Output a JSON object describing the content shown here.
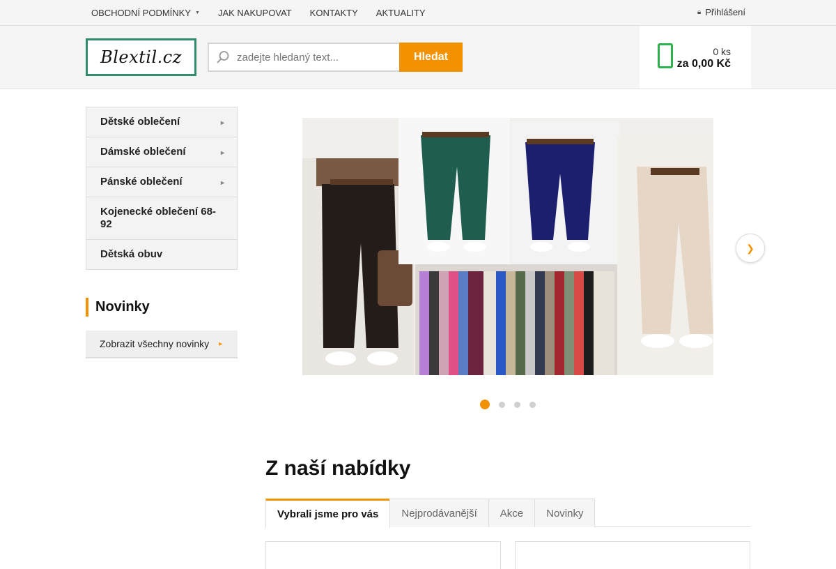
{
  "topnav": {
    "items": [
      "OBCHODNÍ PODMÍNKY",
      "JAK NAKUPOVAT",
      "KONTAKTY",
      "AKTUALITY"
    ],
    "login": "Přihlášení"
  },
  "header": {
    "logo_text": "Blextil.cz",
    "search_placeholder": "zadejte hledaný text...",
    "search_button": "Hledat",
    "cart_qty": "0 ks",
    "cart_total": "za 0,00 Kč"
  },
  "sidebar": {
    "categories": [
      {
        "label": "Dětské oblečení",
        "has_sub": true
      },
      {
        "label": "Dámské oblečení",
        "has_sub": true
      },
      {
        "label": "Pánské oblečení",
        "has_sub": true
      },
      {
        "label": "Kojenecké oblečení 68-92",
        "has_sub": false
      },
      {
        "label": "Dětská obuv",
        "has_sub": false
      }
    ],
    "news_title": "Novinky",
    "news_button": "Zobrazit všechny novinky"
  },
  "banner": {
    "slide_count": 4,
    "active_slide": 1
  },
  "offer": {
    "title": "Z naší nabídky",
    "tabs": [
      "Vybrali jsme pro vás",
      "Nejprodávanější",
      "Akce",
      "Novinky"
    ],
    "active_tab": 0
  },
  "colors": {
    "accent": "#f39200",
    "cart_green": "#2bb24c",
    "logo_border": "#2f8a6e"
  }
}
